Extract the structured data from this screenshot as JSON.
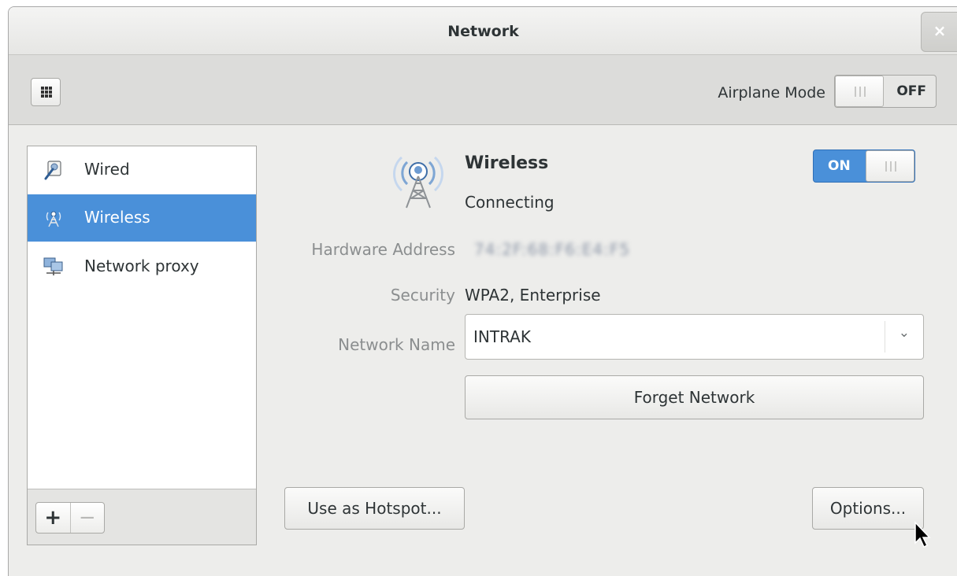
{
  "window": {
    "title": "Network",
    "close_glyph": "×"
  },
  "toolbar": {
    "grid_icon": "app-grid-icon",
    "airplane_label": "Airplane Mode",
    "airplane_state": "OFF"
  },
  "sidebar": {
    "items": [
      {
        "label": "Wired",
        "icon": "wired-icon",
        "selected": false
      },
      {
        "label": "Wireless",
        "icon": "wireless-icon",
        "selected": true
      },
      {
        "label": "Network proxy",
        "icon": "network-proxy-icon",
        "selected": false
      }
    ],
    "add_label": "+",
    "remove_label": "−"
  },
  "device": {
    "name": "Wireless",
    "status": "Connecting",
    "switch_state": "ON",
    "icon": "wireless-tower-icon"
  },
  "details": {
    "hardware_label": "Hardware Address",
    "hardware_value": "74:2F:68:F6:E4:F5",
    "security_label": "Security",
    "security_value": "WPA2, Enterprise",
    "network_name_label": "Network Name",
    "network_name_value": "INTRAK"
  },
  "buttons": {
    "forget": "Forget Network",
    "hotspot": "Use as Hotspot...",
    "options": "Options..."
  },
  "colors": {
    "accent": "#4a90d9",
    "window_bg": "#ededeb",
    "text": "#2e3436",
    "dim_text": "#8b8e8f"
  }
}
